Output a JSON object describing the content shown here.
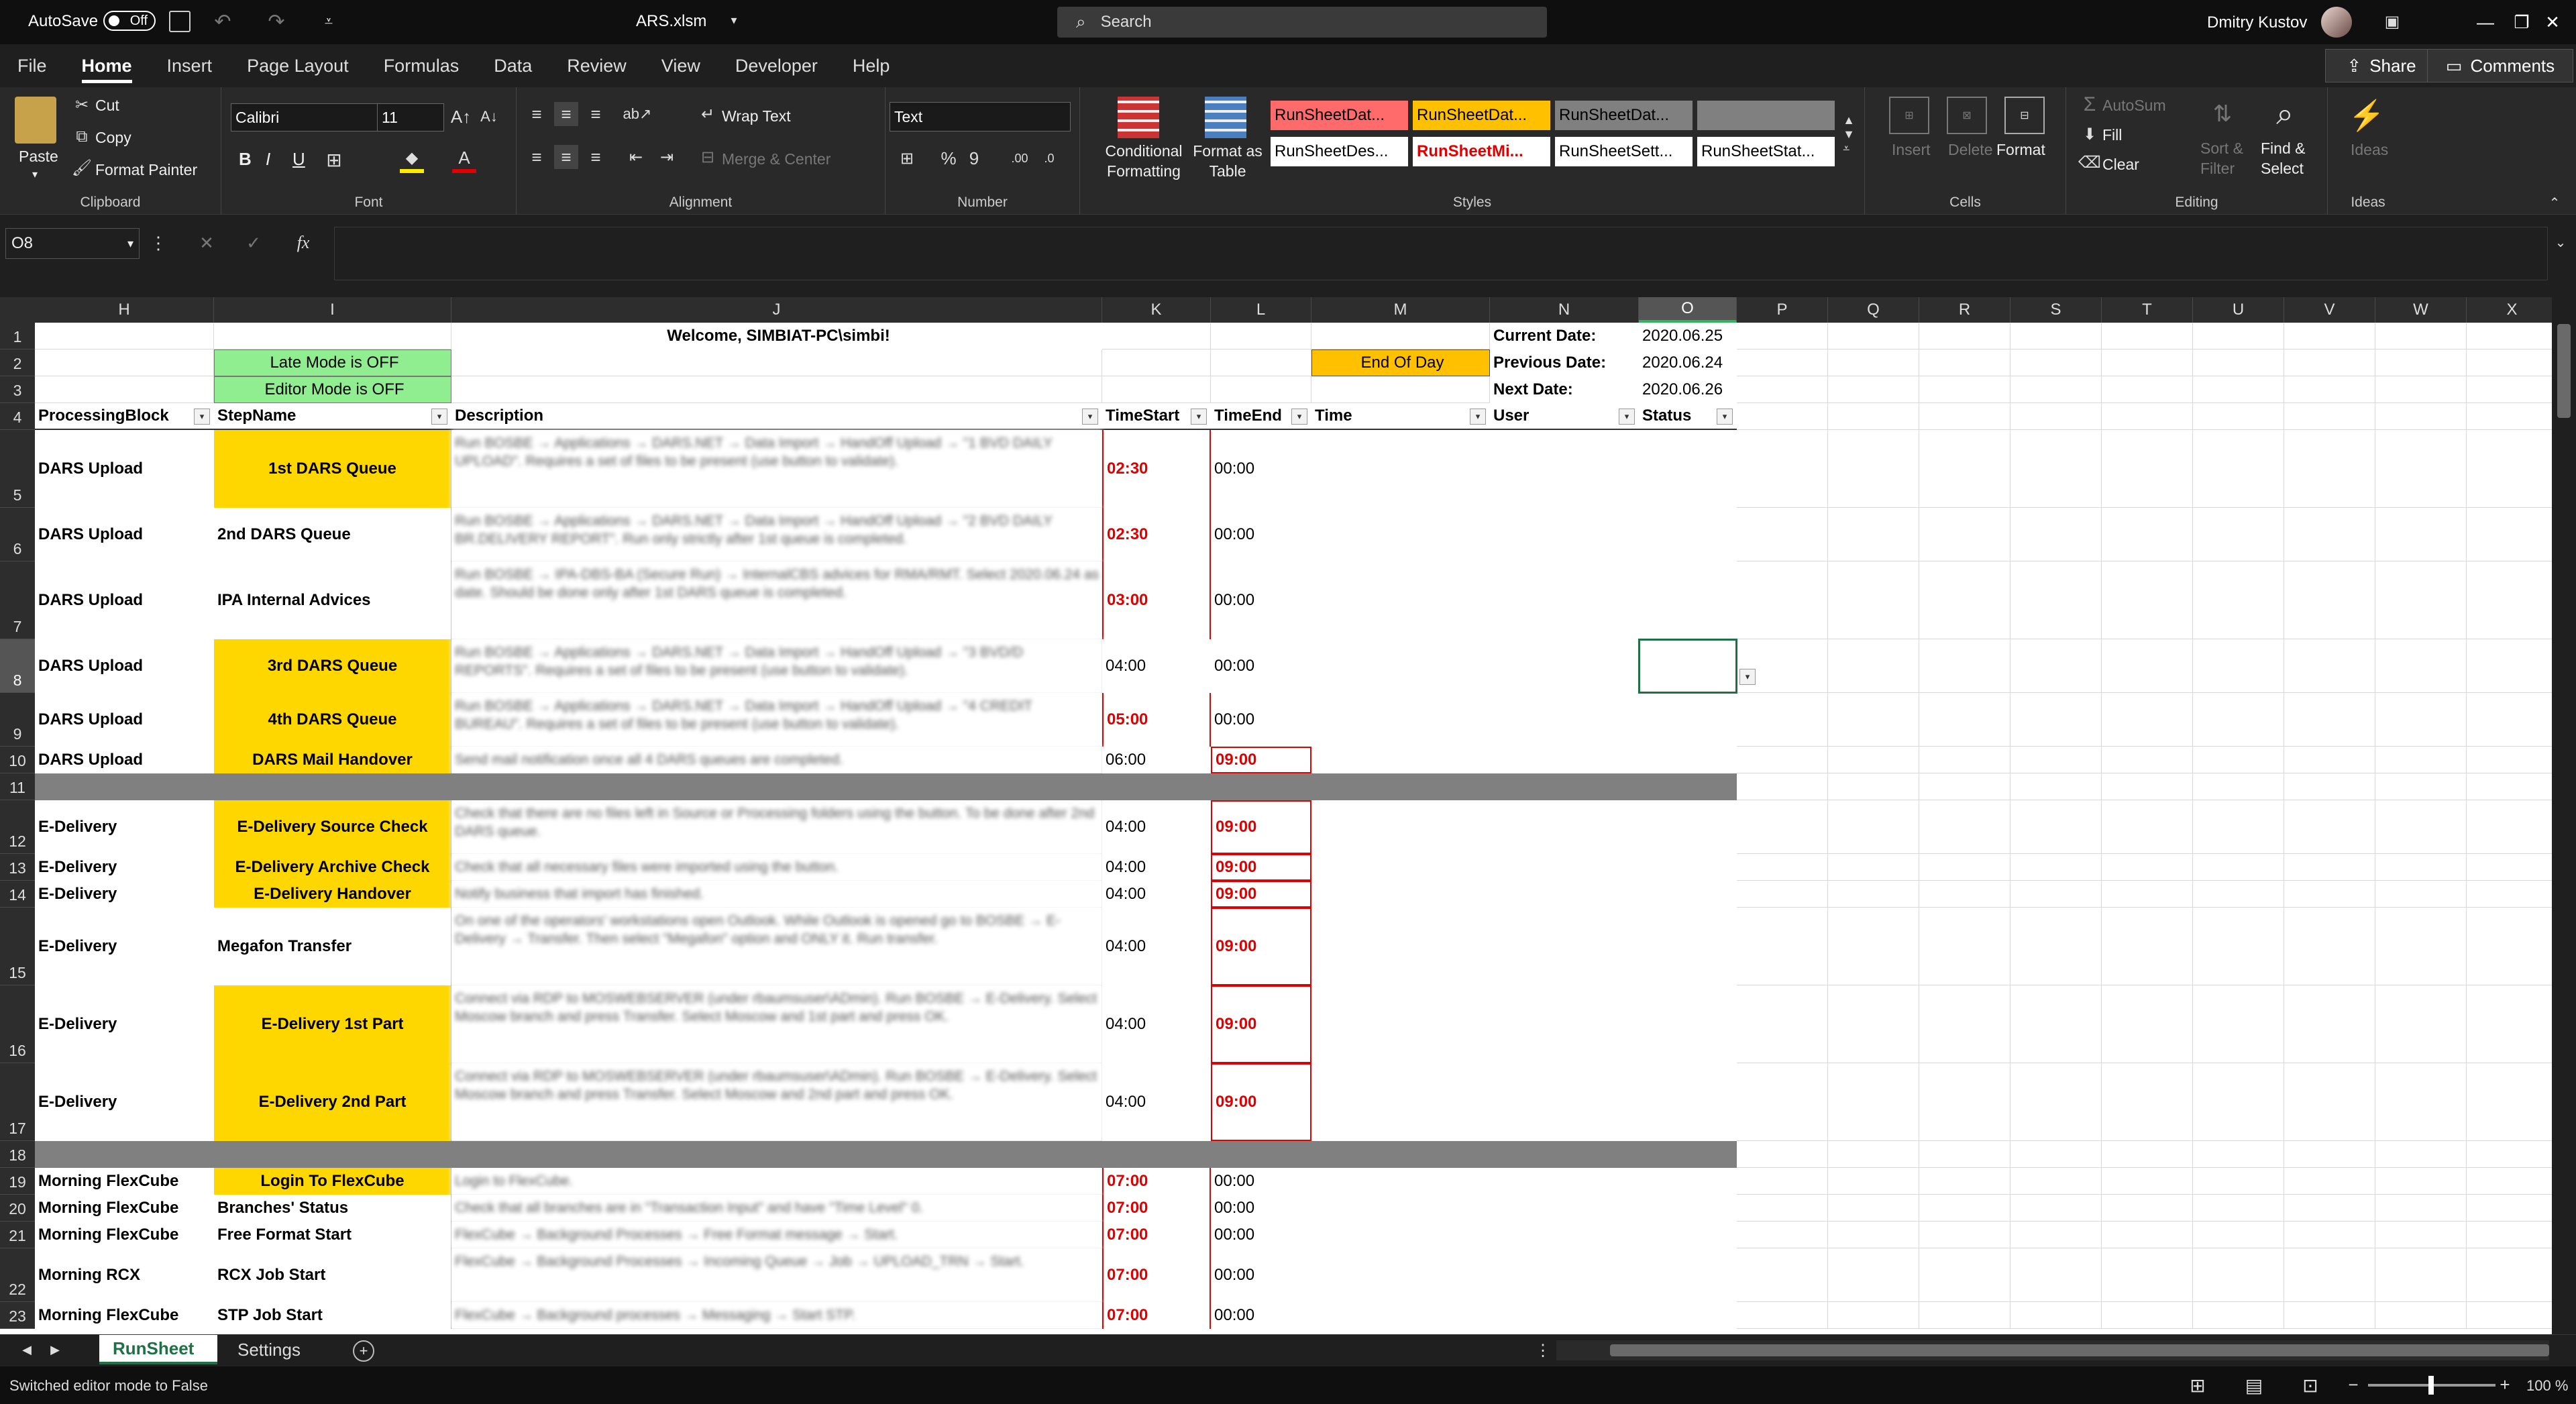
{
  "titlebar": {
    "autosave_label": "AutoSave",
    "autosave_state": "Off",
    "filename": "ARS.xlsm",
    "search_placeholder": "Search",
    "user": "Dmitry Kustov"
  },
  "menu": {
    "items": [
      "File",
      "Home",
      "Insert",
      "Page Layout",
      "Formulas",
      "Data",
      "Review",
      "View",
      "Developer",
      "Help"
    ],
    "active": "Home",
    "share": "Share",
    "comments": "Comments"
  },
  "ribbon": {
    "clipboard": {
      "paste": "Paste",
      "cut": "Cut",
      "copy": "Copy",
      "format_painter": "Format Painter",
      "label": "Clipboard"
    },
    "font": {
      "name": "Calibri",
      "size": "11",
      "bold": "B",
      "italic": "I",
      "underline": "U",
      "label": "Font"
    },
    "alignment": {
      "wrap_text": "Wrap Text",
      "merge_center": "Merge & Center",
      "label": "Alignment"
    },
    "number": {
      "format": "Text",
      "label": "Number"
    },
    "styles": {
      "conditional": "Conditional Formatting",
      "format_as_table": "Format as Table",
      "boxes": [
        "RunSheetDat...",
        "RunSheetDat...",
        "RunSheetDat...",
        "",
        "RunSheetDes...",
        "RunSheetMi...",
        "RunSheetSett...",
        "RunSheetStat..."
      ],
      "label": "Styles"
    },
    "cells": {
      "insert": "Insert",
      "delete": "Delete",
      "format": "Format",
      "label": "Cells"
    },
    "editing": {
      "autosum": "AutoSum",
      "fill": "Fill",
      "clear": "Clear",
      "sort_filter": "Sort & Filter",
      "find_select": "Find & Select",
      "label": "Editing"
    },
    "ideas": {
      "label": "Ideas",
      "ideas": "Ideas"
    }
  },
  "formula_bar": {
    "name_box": "O8",
    "fx": "fx",
    "value": ""
  },
  "columns": [
    "H",
    "I",
    "J",
    "K",
    "L",
    "M",
    "N",
    "O",
    "P",
    "Q",
    "R",
    "S",
    "T",
    "U",
    "V",
    "W",
    "X"
  ],
  "rows": [
    "1",
    "2",
    "3",
    "4",
    "5",
    "6",
    "7",
    "8",
    "9",
    "10",
    "11",
    "12",
    "13",
    "14",
    "15",
    "16",
    "17",
    "18",
    "19",
    "20",
    "21",
    "22",
    "23"
  ],
  "sheet": {
    "welcome": "Welcome, SIMBIAT-PC\\simbi!",
    "late_mode": "Late Mode is OFF",
    "editor_mode": "Editor Mode is OFF",
    "end_of_day": "End Of Day",
    "current_date_label": "Current Date:",
    "current_date": "2020.06.25",
    "previous_date_label": "Previous Date:",
    "previous_date": "2020.06.24",
    "next_date_label": "Next Date:",
    "next_date": "2020.06.26",
    "headers": [
      "ProcessingBlock",
      "StepName",
      "Description",
      "TimeStart",
      "TimeEnd",
      "Time",
      "User",
      "Status"
    ],
    "data_rows": [
      {
        "block": "DARS Upload",
        "step": "1st DARS Queue",
        "yellow": true,
        "desc": "Run BOSBE → Applications → DARS.NET → Data Import → HandOff Upload → \"1 BVD DAILY UPLOAD\". Requires a set of files to be present (use button to validate).",
        "start": "02:30",
        "end": "00:00"
      },
      {
        "block": "DARS Upload",
        "step": "2nd DARS Queue",
        "yellow": false,
        "desc": "Run BOSBE → Applications → DARS.NET → Data Import → HandOff Upload → \"2 BVD DAILY BR.DELIVERY REPORT\". Run only strictly after 1st queue is completed.",
        "start": "02:30",
        "end": "00:00"
      },
      {
        "block": "DARS Upload",
        "step": "IPA Internal Advices",
        "yellow": false,
        "desc": "Run BOSBE → IPA-DBS-BA (Secure Run) → InternalCBS advices for RMA/RMT. Select 2020.06.24 as date. Should be done only after 1st DARS queue is completed.",
        "start": "03:00",
        "end": "00:00"
      },
      {
        "block": "DARS Upload",
        "step": "3rd DARS Queue",
        "yellow": true,
        "desc": "Run BOSBE → Applications → DARS.NET → Data Import → HandOff Upload → \"3 BVD/D REPORTS\". Requires a set of files to be present (use button to validate).",
        "start": "04:00",
        "end": "00:00"
      },
      {
        "block": "DARS Upload",
        "step": "4th DARS Queue",
        "yellow": true,
        "desc": "Run BOSBE → Applications → DARS.NET → Data Import → HandOff Upload → \"4 CREDIT BUREAU\". Requires a set of files to be present (use button to validate).",
        "start": "05:00",
        "end": "00:00"
      },
      {
        "block": "DARS Upload",
        "step": "DARS Mail Handover",
        "yellow": true,
        "desc": "Send mail notification once all 4 DARS queues are completed.",
        "start": "06:00",
        "end": "09:00"
      },
      {
        "block": "E-Delivery",
        "step": "E-Delivery Source Check",
        "yellow": true,
        "desc": "Check that there are no files left in Source or Processing folders using the button. To be done after 2nd DARS queue.",
        "start": "04:00",
        "end": "09:00"
      },
      {
        "block": "E-Delivery",
        "step": "E-Delivery Archive Check",
        "yellow": true,
        "desc": "Check that all necessary files were imported using the button.",
        "start": "04:00",
        "end": "09:00"
      },
      {
        "block": "E-Delivery",
        "step": "E-Delivery Handover",
        "yellow": true,
        "desc": "Notify business that import has finished.",
        "start": "04:00",
        "end": "09:00"
      },
      {
        "block": "E-Delivery",
        "step": "Megafon Transfer",
        "yellow": false,
        "desc": "On one of the operators' workstations open Outlook. While Outlook is opened go to BOSBE → E-Delivery → Transfer. Then select \"Megafon\" option and ONLY it. Run transfer.",
        "start": "04:00",
        "end": "09:00"
      },
      {
        "block": "E-Delivery",
        "step": "E-Delivery 1st Part",
        "yellow": true,
        "desc": "Connect via RDP to MOSWEBSERVER (under rbaumsuser\\ADmin). Run BOSBE → E-Delivery. Select Moscow branch and press Transfer. Select Moscow and 1st part and press OK.",
        "start": "04:00",
        "end": "09:00"
      },
      {
        "block": "E-Delivery",
        "step": "E-Delivery 2nd Part",
        "yellow": true,
        "desc": "Connect via RDP to MOSWEBSERVER (under rbaumsuser\\ADmin). Run BOSBE → E-Delivery. Select Moscow branch and press Transfer. Select Moscow and 2nd part and press OK.",
        "start": "04:00",
        "end": "09:00"
      },
      {
        "block": "Morning FlexCube",
        "step": "Login To FlexCube",
        "yellow": true,
        "desc": "Login to FlexCube.",
        "start": "07:00",
        "end": "00:00"
      },
      {
        "block": "Morning FlexCube",
        "step": "Branches' Status",
        "yellow": false,
        "desc": "Check that all branches are in \"Transaction Input\" and have \"Time Level\" 0.",
        "start": "07:00",
        "end": "00:00"
      },
      {
        "block": "Morning FlexCube",
        "step": "Free Format Start",
        "yellow": false,
        "desc": "FlexCube → Background Processes → Free Format message → Start.",
        "start": "07:00",
        "end": "00:00"
      },
      {
        "block": "Morning RCX",
        "step": "RCX Job Start",
        "yellow": false,
        "desc": "FlexCube → Background Processes → Incoming Queue → Job → UPLOAD_TRN → Start.",
        "start": "07:00",
        "end": "00:00"
      },
      {
        "block": "Morning FlexCube",
        "step": "STP Job Start",
        "yellow": false,
        "desc": "FlexCube → Background processes → Messaging → Start STP.",
        "start": "07:00",
        "end": "00:00"
      }
    ]
  },
  "tabs": [
    "RunSheet",
    "Settings"
  ],
  "status": {
    "message": "Switched editor mode to False",
    "zoom": "100 %"
  }
}
